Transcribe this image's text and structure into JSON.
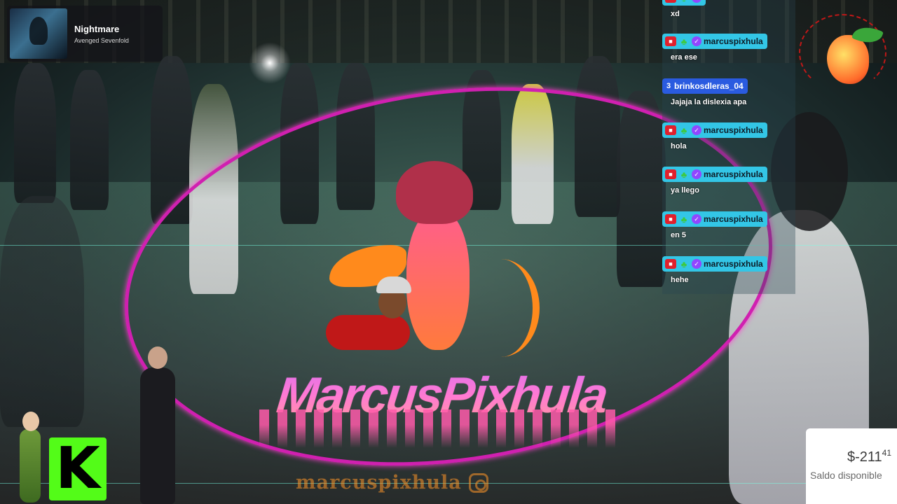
{
  "now_playing": {
    "title": "Nightmare",
    "artist": "Avenged Sevenfold",
    "art_icon": "album-art"
  },
  "chat": {
    "messages": [
      {
        "user": "",
        "text": "xd",
        "badges": [
          "camera-icon",
          "leaf-icon",
          "verified-icon"
        ],
        "highlight": "#33c6e6"
      },
      {
        "user": "marcuspixhula",
        "text": "era ese",
        "badges": [
          "camera-icon",
          "leaf-icon",
          "verified-icon"
        ],
        "highlight": "#33c6e6"
      },
      {
        "user": "brinkosdleras_04",
        "text": "Jajaja la dislexia apa",
        "badges": [
          "3"
        ],
        "highlight": "#2a5be0"
      },
      {
        "user": "marcuspixhula",
        "text": "hola",
        "badges": [
          "camera-icon",
          "leaf-icon",
          "verified-icon"
        ],
        "highlight": "#33c6e6"
      },
      {
        "user": "marcuspixhula",
        "text": "ya llego",
        "badges": [
          "camera-icon",
          "leaf-icon",
          "verified-icon"
        ],
        "highlight": "#33c6e6"
      },
      {
        "user": "marcuspixhula",
        "text": "en 5",
        "badges": [
          "camera-icon",
          "leaf-icon",
          "verified-icon"
        ],
        "highlight": "#33c6e6"
      },
      {
        "user": "marcuspixhula",
        "text": "hehe",
        "badges": [
          "camera-icon",
          "leaf-icon",
          "verified-icon"
        ],
        "highlight": "#33c6e6"
      }
    ]
  },
  "overlay": {
    "logo_text": "MarcusPixhula",
    "watermark": "marcuspixhula",
    "watermark_icon": "instagram-icon",
    "kick_letter": "K",
    "kick_color": "#53fc18",
    "ring_color": "#d020b0"
  },
  "balance": {
    "amount_main": "$-211",
    "amount_cents": "41",
    "label": "Saldo disponible"
  }
}
